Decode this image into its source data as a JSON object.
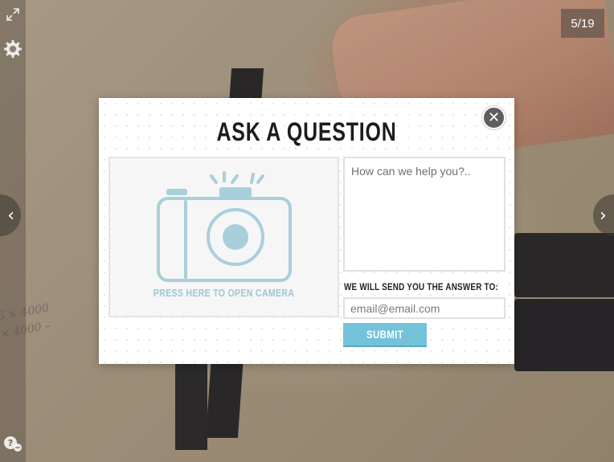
{
  "viewer": {
    "counter": "5/19",
    "fullscreen_icon": "expand-arrows-icon",
    "settings_icon": "gear-icon",
    "help_icon": "help-chat-icon",
    "prev_icon": "chevron-left-icon",
    "next_icon": "chevron-right-icon"
  },
  "background": {
    "scribble_line1": "6 × 4000",
    "scribble_line2": "× 4000 –"
  },
  "modal": {
    "title": "ASK A QUESTION",
    "close_icon": "close-icon",
    "camera": {
      "icon": "camera-icon",
      "label": "PRESS HERE TO OPEN CAMERA",
      "color": "#a9cfdb"
    },
    "question": {
      "placeholder": "How can we help you?..",
      "value": ""
    },
    "email": {
      "label": "WE WILL SEND YOU THE ANSWER TO:",
      "placeholder": "email@email.com",
      "value": ""
    },
    "submit_label": "SUBMIT",
    "accent_color": "#74c2d9"
  }
}
